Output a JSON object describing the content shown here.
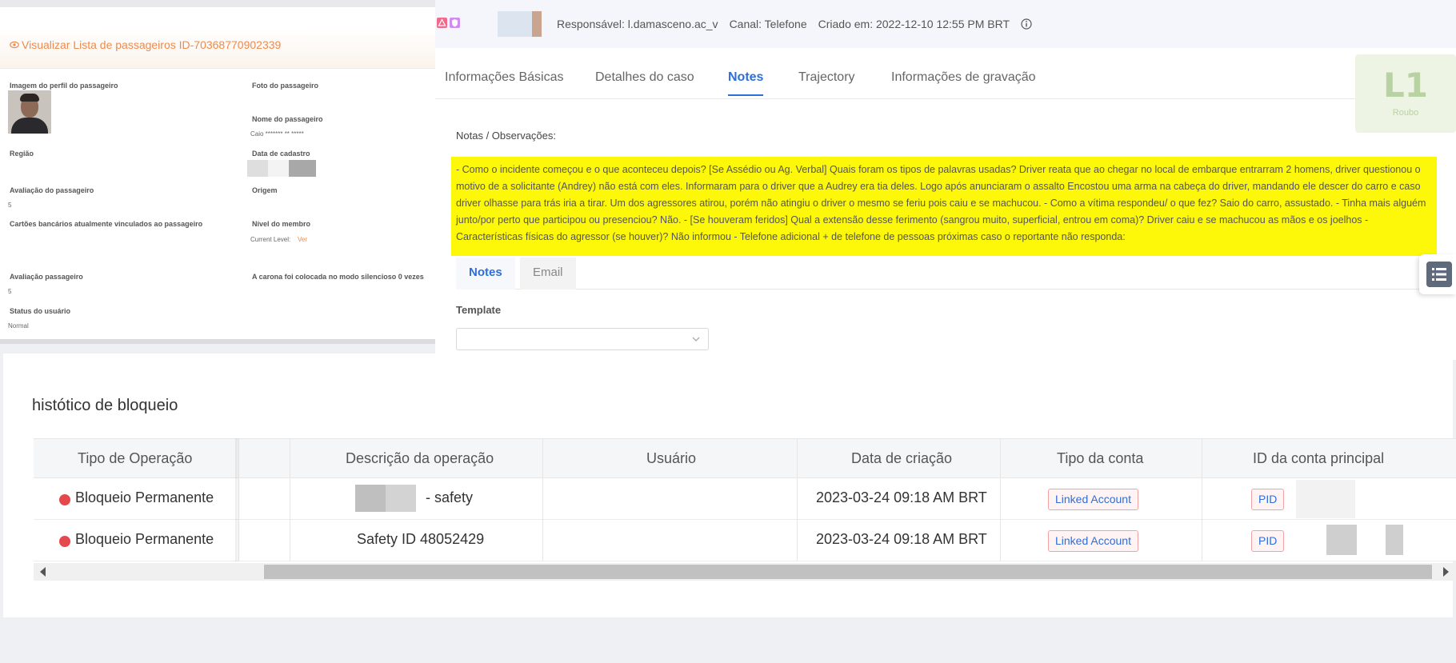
{
  "passenger_panel": {
    "title": "Visualizar Lista de passageiros ID-70368770902339",
    "fields": {
      "profile_image_label": "Imagem do perfil do passageiro",
      "photo_label": "Foto do passageiro",
      "name_label": "Nome do passageiro",
      "name_value": "Caio ******* ** *****",
      "region_label": "Região",
      "signup_date_label": "Data de cadastro",
      "rating_label": "Avaliação do passageiro",
      "rating_value": "5",
      "origin_label": "Origem",
      "cards_label": "Cartões bancários atualmente vinculados ao passageiro",
      "member_level_label": "Nível do membro",
      "current_level_label": "Current Level:",
      "current_level_link": "Ver",
      "rating2_label": "Avaliação passageiro",
      "rating2_value": "5",
      "silent_ride_label": "A carona foi colocada no modo silencioso 0 vezes",
      "status_label": "Status do usuário",
      "status_value": "Normal"
    }
  },
  "case_panel": {
    "meta": {
      "responsible": "Responsável: l.damasceno.ac_v",
      "channel": "Canal: Telefone",
      "created": "Criado em: 2022-12-10 12:55 PM BRT"
    },
    "tabs": [
      "Informações Básicas",
      "Detalhes do caso",
      "Notes",
      "Trajectory",
      "Informações de gravação"
    ],
    "active_tab": "Notes",
    "level_badge": {
      "code": "L1",
      "label": "Roubo"
    },
    "notes_label": "Notas / Observações:",
    "notes_text": "- Como o incidente começou e o que aconteceu depois? [Se Assédio ou Ag. Verbal] Quais foram os tipos de palavras usadas? Driver reata que ao chegar no local de embarque entrarram 2 homens, driver questionou o motivo de a solicitante (Andrey) não está com eles. Informaram para o driver que a Audrey era tia deles. Logo após anunciaram o assalto Encostou uma arma na cabeça do driver, mandando ele descer do carro e caso driver olhasse para trás iria a tirar. Um dos agressores atirou, porém não atingiu o driver o mesmo se feriu pois caiu e se machucou. - Como a vítima respondeu/ o que fez? Saio do carro, assustado. - Tinha mais alguém junto/por perto que participou ou presenciou? Não. - [Se houveram feridos] Qual a extensão desse ferimento (sangrou muito, superficial, entrou em coma)? Driver caiu e se machucou as mãos e os joelhos - Características físicas do agressor (se houver)? Não informou - Telefone adicional + de telefone de pessoas próximas caso o reportante não responda:",
    "subtabs": [
      "Notes",
      "Email"
    ],
    "template_label": "Template",
    "template_value": ""
  },
  "block_history": {
    "title": "histótico de bloqueio",
    "columns": [
      "Tipo de Operação",
      "Descrição da operação",
      "Usuário",
      "Data de criação",
      "Tipo da conta",
      "ID da conta principal"
    ],
    "rows": [
      {
        "type": "Bloqueio Permanente",
        "description": "- safety",
        "user": "",
        "created": "2023-03-24 09:18 AM BRT",
        "account_type": "Linked Account",
        "main_id": "PID"
      },
      {
        "type": "Bloqueio Permanente",
        "description": "Safety ID 48052429",
        "user": "",
        "created": "2023-03-24 09:18 AM BRT",
        "account_type": "Linked Account",
        "main_id": "PID"
      }
    ]
  },
  "colors": {
    "accent_blue": "#2e6fd8",
    "orange_title": "#ef8a4c",
    "highlight_yellow": "#fdf80a",
    "status_red": "#e5484d"
  }
}
